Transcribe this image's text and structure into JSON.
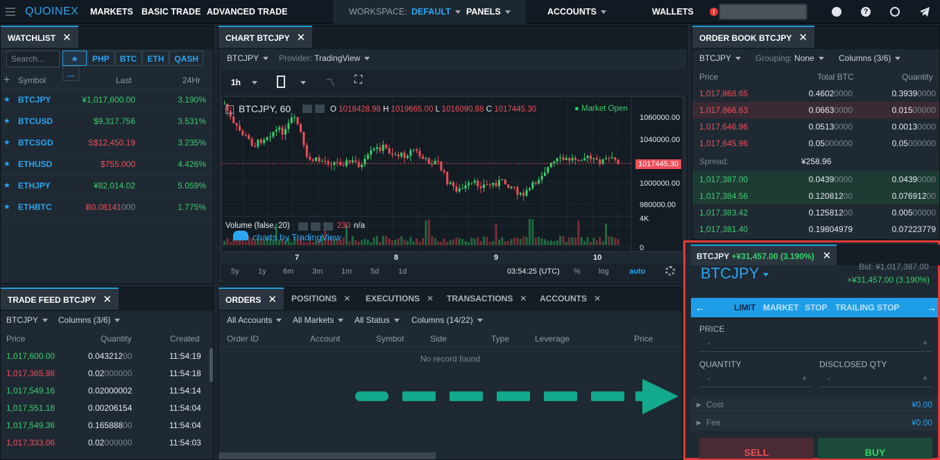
{
  "brand": {
    "name": "QUOINEX"
  },
  "nav": {
    "markets": "MARKETS",
    "basic_trade": "BASIC TRADE",
    "advanced_trade": "ADVANCED TRADE",
    "workspace_label": "WORKSPACE:",
    "workspace_value": "DEFAULT",
    "panels": "PANELS",
    "accounts": "ACCOUNTS",
    "wallets": "WALLETS"
  },
  "watchlist": {
    "title": "WATCHLIST",
    "search_placeholder": "Search...",
    "filters": [
      "★",
      "PHP",
      "BTC",
      "ETH",
      "QASH",
      "..."
    ],
    "headers": {
      "symbol": "Symbol",
      "last": "Last",
      "change": "24Hr"
    },
    "rows": [
      {
        "symbol": "BTCJPY",
        "last": "¥1,017,600.00",
        "change": "3.190%",
        "color": "g"
      },
      {
        "symbol": "BTCUSD",
        "last": "$9,317.756",
        "change": "3.531%",
        "color": "g"
      },
      {
        "symbol": "BTCSGD",
        "last": "S$12,450.19",
        "change": "3.235%",
        "color": "r"
      },
      {
        "symbol": "ETHUSD",
        "last": "$755.000",
        "change": "4.426%",
        "color": "r"
      },
      {
        "symbol": "ETHJPY",
        "last": "¥82,014.02",
        "change": "5.059%",
        "color": "g"
      },
      {
        "symbol": "ETHBTC",
        "last": "Ƀ0.08141",
        "last_dim": "000",
        "change": "1.775%",
        "color": "r"
      }
    ]
  },
  "chart": {
    "title": "CHART BTCJPY",
    "pair": "BTCJPY",
    "provider_label": "Provider:",
    "provider": "TradingView",
    "interval": "1h",
    "legend": {
      "symbol": "BTCJPY, 60",
      "o_label": "O",
      "o": "1018428.98",
      "h_label": "H",
      "h": "1019665.00",
      "l_label": "L",
      "l": "1016090.88",
      "c_label": "C",
      "c": "1017445.30"
    },
    "market_status": "Market Open",
    "price_ticks": [
      "1060000.00",
      "1040000.00",
      "1000000.00",
      "980000.00"
    ],
    "current_price": "1017445.30",
    "volume_label": "Volume (false, 20)",
    "volume_value": "230",
    "volume_na": "n/a",
    "volume_ticks": [
      "4K",
      "0"
    ],
    "watermark": "charts by TradingView",
    "dates": [
      "7",
      "8",
      "9",
      "10"
    ],
    "ranges": [
      "5y",
      "1y",
      "6m",
      "3m",
      "1m",
      "5d",
      "1d"
    ],
    "time": "03:54:25 (UTC)",
    "pct": "%",
    "log": "log",
    "auto": "auto"
  },
  "orderbook": {
    "title": "ORDER BOOK BTCJPY",
    "pair": "BTCJPY",
    "grouping_label": "Grouping:",
    "grouping": "None",
    "columns": "Columns (3/6)",
    "headers": {
      "price": "Price",
      "total": "Total BTC",
      "qty": "Quantity"
    },
    "asks": [
      {
        "price": "1,017,868.65",
        "total": "0.4602",
        "total_dim": "0000",
        "qty": "0.3939",
        "qty_dim": "0000"
      },
      {
        "price": "1,017,866.63",
        "total": "0.0663",
        "total_dim": "0000",
        "qty": "0.015",
        "qty_dim": "00000"
      },
      {
        "price": "1,017,646.96",
        "total": "0.0513",
        "total_dim": "0000",
        "qty": "0.0013",
        "qty_dim": "0000"
      },
      {
        "price": "1,017,645.96",
        "total": "0.05",
        "total_dim": "000000",
        "qty": "0.05",
        "qty_dim": "000000"
      }
    ],
    "spread_label": "Spread:",
    "spread": "¥258.96",
    "bids": [
      {
        "price": "1,017,387.00",
        "total": "0.0439",
        "total_dim": "0000",
        "qty": "0.0439",
        "qty_dim": "0000"
      },
      {
        "price": "1,017,384.56",
        "total": "0.120812",
        "total_dim": "00",
        "qty": "0.076912",
        "qty_dim": "00"
      },
      {
        "price": "1,017,383.42",
        "total": "0.125812",
        "total_dim": "00",
        "qty": "0.005",
        "qty_dim": "00000"
      },
      {
        "price": "1,017,381.40",
        "total": "0.19804979",
        "total_dim": "",
        "qty": "0.07223779",
        "qty_dim": ""
      }
    ]
  },
  "order_entry": {
    "tab": "BTCJPY",
    "tab_change": "+¥31,457.00 (3.190%)",
    "pair": "BTCJPY",
    "bid": "Bid: ¥1,017,387.00",
    "change": "+¥31,457.00 (3.190%)",
    "types": [
      "LIMIT",
      "MARKET",
      "STOP",
      "TRAILING STOP"
    ],
    "price_label": "PRICE",
    "quantity_label": "QUANTITY",
    "disclosed_label": "DISCLOSED QTY",
    "minus": "-",
    "plus": "+",
    "cost_label": "Cost",
    "cost": "¥0.00",
    "fee_label": "Fee",
    "fee": "¥0.00",
    "sell": "SELL",
    "buy": "BUY"
  },
  "tradefeed": {
    "title": "TRADE FEED BTCJPY",
    "pair": "BTCJPY",
    "columns": "Columns (3/6)",
    "headers": {
      "price": "Price",
      "qty": "Quantity",
      "created": "Created"
    },
    "rows": [
      {
        "price": "1,017,600.00",
        "qty": "0.043212",
        "qty_dim": "00",
        "time": "11:54:19",
        "color": "g"
      },
      {
        "price": "1,017,365.98",
        "qty": "0.02",
        "qty_dim": "000000",
        "time": "11:54:18",
        "color": "r"
      },
      {
        "price": "1,017,549.16",
        "qty": "0.02000002",
        "qty_dim": "",
        "time": "11:54:14",
        "color": "g"
      },
      {
        "price": "1,017,551.18",
        "qty": "0.00206154",
        "qty_dim": "",
        "time": "11:54:04",
        "color": "g"
      },
      {
        "price": "1,017,549.36",
        "qty": "0.165888",
        "qty_dim": "00",
        "time": "11:54:04",
        "color": "g"
      },
      {
        "price": "1,017,333.06",
        "qty": "0.02",
        "qty_dim": "000000",
        "time": "11:54:03",
        "color": "r"
      }
    ]
  },
  "orders": {
    "tabs": [
      "ORDERS",
      "POSITIONS",
      "EXECUTIONS",
      "TRANSACTIONS",
      "ACCOUNTS"
    ],
    "filters": [
      "All Accounts",
      "All Markets",
      "All Status",
      "Columns (14/22)"
    ],
    "headers": [
      "Order ID",
      "Account",
      "Symbol",
      "Side",
      "Type",
      "Leverage",
      "Price"
    ],
    "empty": "No record found"
  },
  "colors": {
    "accent": "#21a0e0",
    "green": "#39d06a",
    "red": "#ef4f5a",
    "highlight": "#e53935",
    "arrow": "#13a98c"
  }
}
